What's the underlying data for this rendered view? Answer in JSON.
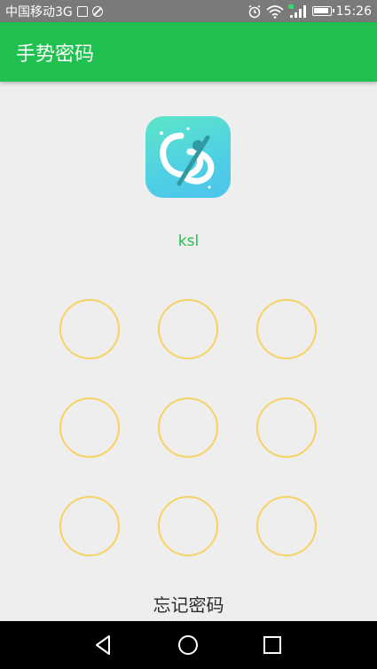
{
  "status_bar": {
    "carrier": "中国移动3G",
    "time": "15:26",
    "icons": [
      "image-icon",
      "blocked-icon",
      "alarm-icon",
      "wifi-icon",
      "signal-icon",
      "battery-icon"
    ]
  },
  "app_bar": {
    "title": "手势密码"
  },
  "profile": {
    "logo_icon": "app-logo-icon",
    "username": "ksl"
  },
  "pattern": {
    "node_color": "#f7d264",
    "nodes": [
      1,
      2,
      3,
      4,
      5,
      6,
      7,
      8,
      9
    ]
  },
  "footer": {
    "forgot_password": "忘记密码"
  },
  "nav_bar": {
    "buttons": [
      "back-icon",
      "home-icon",
      "recents-icon"
    ]
  },
  "colors": {
    "primary": "#21c151",
    "background": "#eeeeee",
    "status_bar": "#7a7a7a",
    "nav_bar": "#000000"
  }
}
